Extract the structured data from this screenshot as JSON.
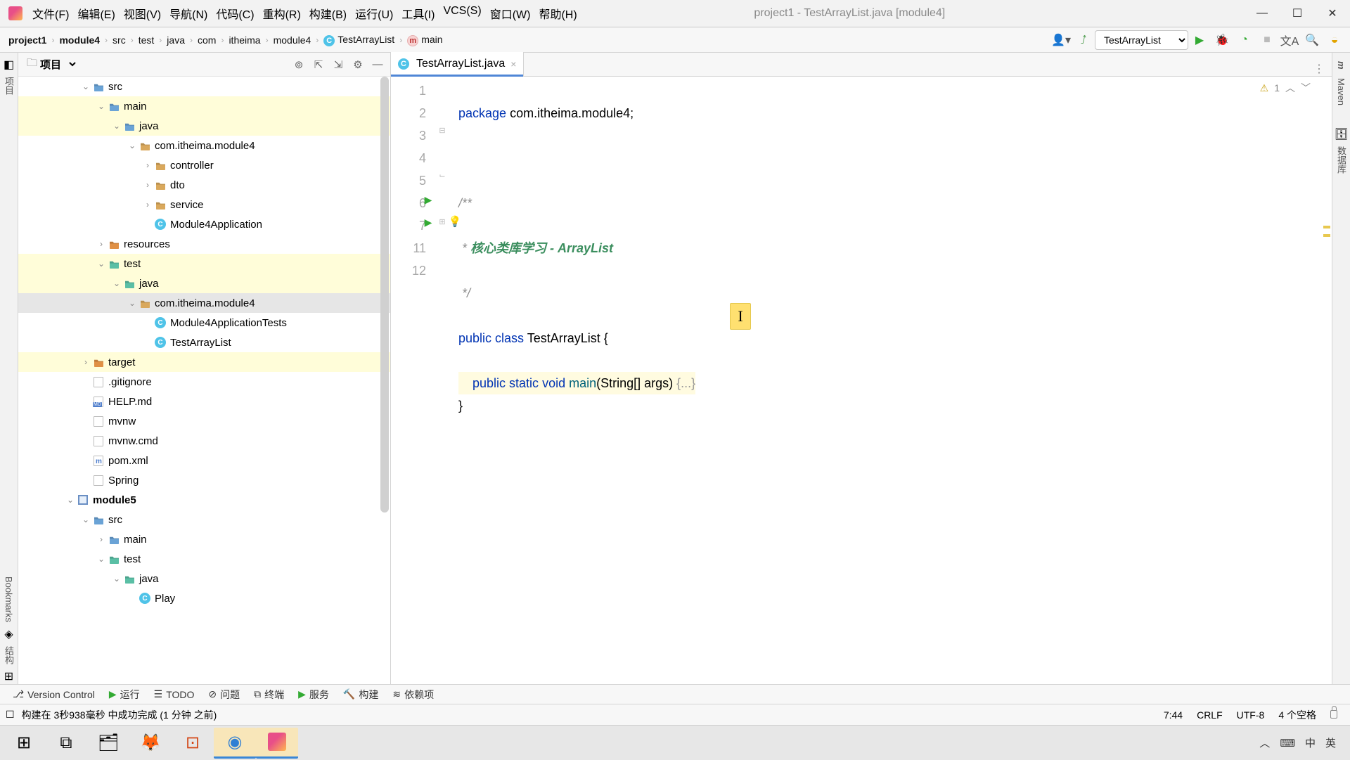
{
  "window": {
    "title": "project1 - TestArrayList.java [module4]"
  },
  "menus": [
    "文件(F)",
    "编辑(E)",
    "视图(V)",
    "导航(N)",
    "代码(C)",
    "重构(R)",
    "构建(B)",
    "运行(U)",
    "工具(I)",
    "VCS(S)",
    "窗口(W)",
    "帮助(H)"
  ],
  "breadcrumb": [
    "project1",
    "module4",
    "src",
    "test",
    "java",
    "com",
    "itheima",
    "module4"
  ],
  "breadcrumb_class": "TestArrayList",
  "breadcrumb_method": "main",
  "run_config": "TestArrayList",
  "proj_label": "项目",
  "tree": [
    {
      "d": 4,
      "a": "v",
      "t": "src",
      "i": "folder-blue"
    },
    {
      "d": 5,
      "a": "v",
      "t": "main",
      "i": "folder-blue",
      "hl": "y"
    },
    {
      "d": 6,
      "a": "v",
      "t": "java",
      "i": "folder-blue",
      "hl": "y"
    },
    {
      "d": 7,
      "a": "v",
      "t": "com.itheima.module4",
      "i": "folder"
    },
    {
      "d": 8,
      "a": ">",
      "t": "controller",
      "i": "folder"
    },
    {
      "d": 8,
      "a": ">",
      "t": "dto",
      "i": "folder"
    },
    {
      "d": 8,
      "a": ">",
      "t": "service",
      "i": "folder"
    },
    {
      "d": 8,
      "a": "",
      "t": "Module4Application",
      "i": "class"
    },
    {
      "d": 5,
      "a": ">",
      "t": "resources",
      "i": "folder-orange"
    },
    {
      "d": 5,
      "a": "v",
      "t": "test",
      "i": "folder-teal",
      "hl": "y"
    },
    {
      "d": 6,
      "a": "v",
      "t": "java",
      "i": "folder-teal",
      "hl": "y"
    },
    {
      "d": 7,
      "a": "v",
      "t": "com.itheima.module4",
      "i": "folder",
      "hl": "sel"
    },
    {
      "d": 8,
      "a": "",
      "t": "Module4ApplicationTests",
      "i": "class"
    },
    {
      "d": 8,
      "a": "",
      "t": "TestArrayList",
      "i": "class"
    },
    {
      "d": 4,
      "a": ">",
      "t": "target",
      "i": "folder-orange",
      "hl": "y"
    },
    {
      "d": 4,
      "a": "",
      "t": ".gitignore",
      "i": "file"
    },
    {
      "d": 4,
      "a": "",
      "t": "HELP.md",
      "i": "md"
    },
    {
      "d": 4,
      "a": "",
      "t": "mvnw",
      "i": "file"
    },
    {
      "d": 4,
      "a": "",
      "t": "mvnw.cmd",
      "i": "file"
    },
    {
      "d": 4,
      "a": "",
      "t": "pom.xml",
      "i": "xml"
    },
    {
      "d": 4,
      "a": "",
      "t": "Spring",
      "i": "file"
    },
    {
      "d": 3,
      "a": "v",
      "t": "module5",
      "i": "module",
      "bold": true
    },
    {
      "d": 4,
      "a": "v",
      "t": "src",
      "i": "folder-blue"
    },
    {
      "d": 5,
      "a": ">",
      "t": "main",
      "i": "folder-blue"
    },
    {
      "d": 5,
      "a": "v",
      "t": "test",
      "i": "folder-teal"
    },
    {
      "d": 6,
      "a": "v",
      "t": "java",
      "i": "folder-teal"
    },
    {
      "d": 7,
      "a": "",
      "t": "Play",
      "i": "class"
    }
  ],
  "tab": {
    "name": "TestArrayList.java"
  },
  "code": {
    "lines": [
      "1",
      "2",
      "3",
      "4",
      "5",
      "6",
      "7",
      "11",
      "12"
    ],
    "l1_kw": "package",
    "l1_rest": " com.itheima.module4;",
    "l3": "/**",
    "l4a": " * ",
    "l4b": "核心类库学习 - ArrayList",
    "l5": " */",
    "l6_pub": "public ",
    "l6_cls": "class",
    "l6_name": " TestArrayList {",
    "l7_pub": "    public ",
    "l7_stat": "static ",
    "l7_void": "void ",
    "l7_main": "main",
    "l7_args": "(String[] args) ",
    "l7_fold": "{...}",
    "l11": "}"
  },
  "inspections": {
    "warnings": "1"
  },
  "bottom": {
    "vc": "Version Control",
    "run": "运行",
    "todo": "TODO",
    "problems": "问题",
    "terminal": "终端",
    "services": "服务",
    "build": "构建",
    "deps": "依赖项"
  },
  "status": {
    "msg": "构建在 3秒938毫秒 中成功完成 (1 分钟 之前)",
    "pos": "7:44",
    "eol": "CRLF",
    "enc": "UTF-8",
    "indent": "4 个空格"
  },
  "sidebars": {
    "left1": "项目",
    "left2": "Bookmarks",
    "left3": "结构",
    "right1": "Maven",
    "right2": "数据库",
    "right3": "m"
  },
  "tray": {
    "ime1": "中",
    "ime2": "英"
  }
}
